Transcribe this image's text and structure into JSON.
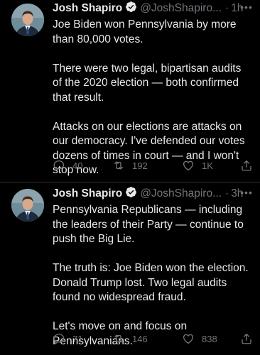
{
  "colors": {
    "background": "#000000",
    "text_primary": "#e7e9ea",
    "text_secondary": "#71767b",
    "verified_badge": "#e7e9ea",
    "divider": "#2f3336"
  },
  "tweets": [
    {
      "author_name": "Josh Shapiro",
      "verified_icon": "verified-badge-icon",
      "handle": "@JoshShapiro...",
      "separator": "·",
      "time": "1h",
      "more_icon": "more-dots-icon",
      "paragraphs": [
        "Joe Biden won Pennsylvania by more than 80,000 votes.",
        "There were two legal, bipartisan audits of the 2020 election — both confirmed that result.",
        "Attacks on our elections are attacks on our democracy. I've defended our votes dozens of times in court — and I won't stop now."
      ],
      "reply_count": "40",
      "retweet_count": "192",
      "like_count": "1K"
    },
    {
      "author_name": "Josh Shapiro",
      "verified_icon": "verified-badge-icon",
      "handle": "@JoshShapiro...",
      "separator": "·",
      "time": "3h",
      "more_icon": "more-dots-icon",
      "paragraphs": [
        "Pennsylvania Republicans — including the leaders of their Party — continue to push the Big Lie.",
        "The truth is: Joe Biden won the election. Donald Trump lost. Two legal audits found no widespread fraud.",
        "Let's move on and focus on Pennsylvanians."
      ],
      "reply_count": "71",
      "retweet_count": "146",
      "like_count": "838"
    }
  ]
}
